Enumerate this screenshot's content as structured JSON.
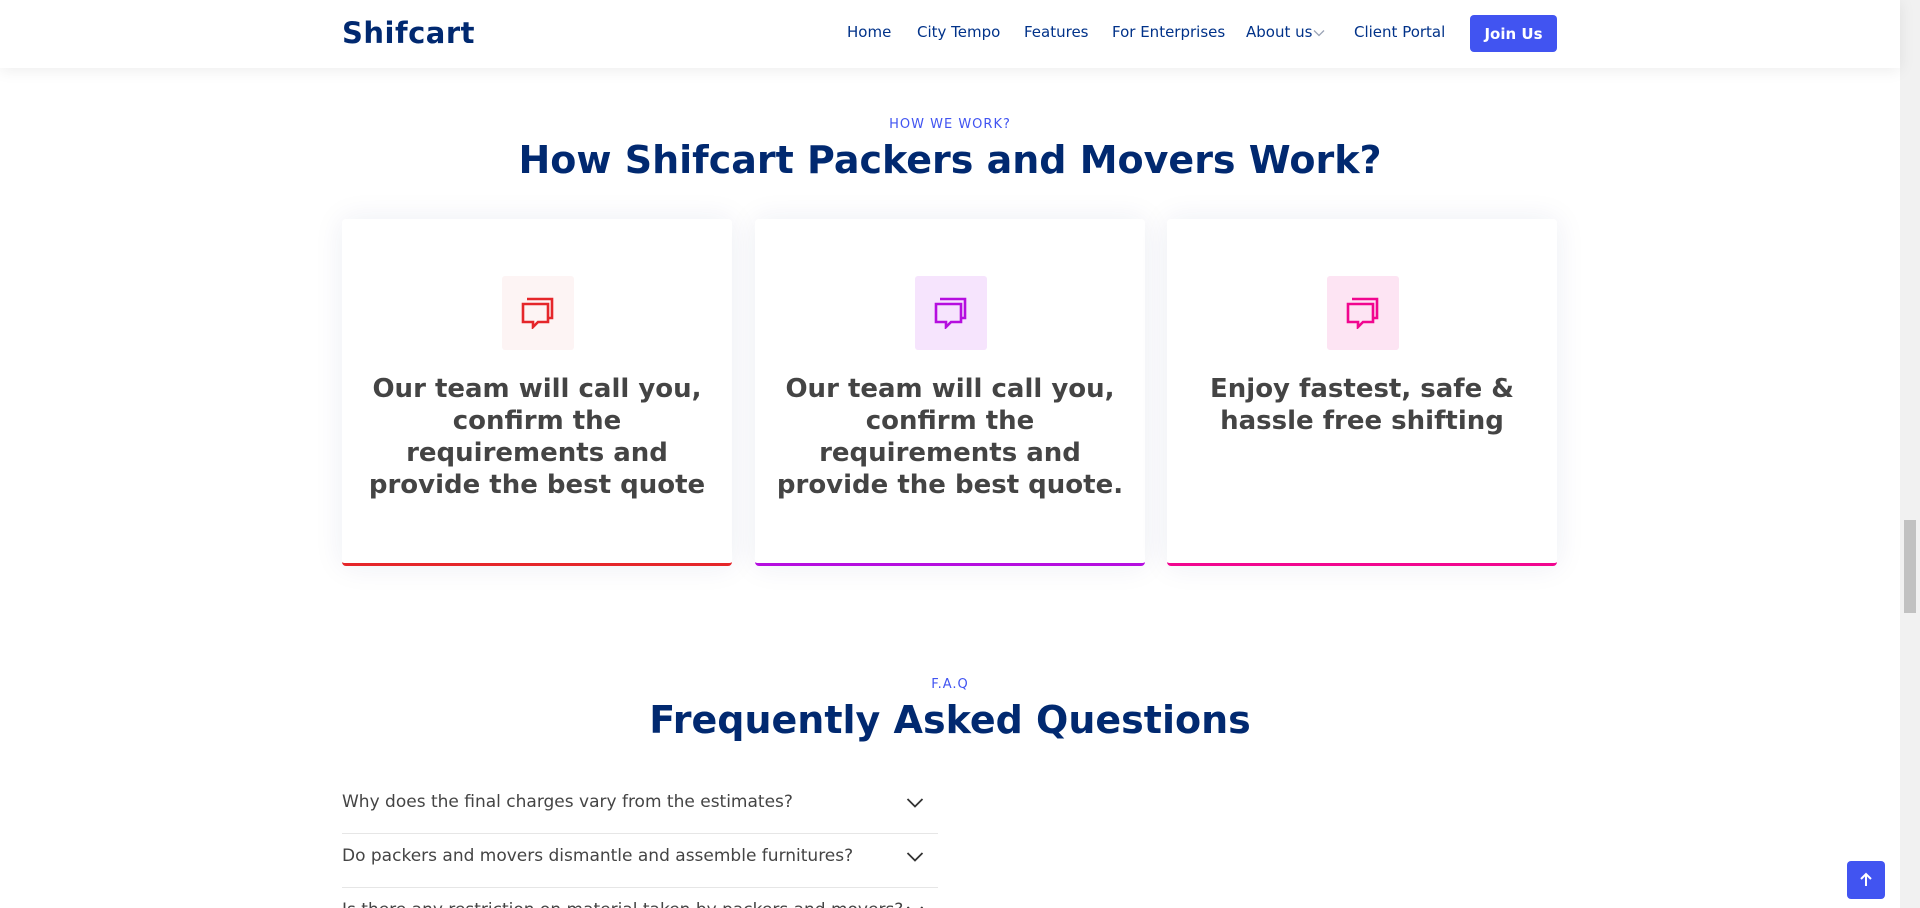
{
  "header": {
    "logo": "Shifcart",
    "nav": [
      "Home",
      "City Tempo",
      "Features",
      "For Enterprises",
      "About us",
      "Client Portal"
    ],
    "join_label": "Join Us",
    "accent": "#4154f1"
  },
  "how": {
    "eyebrow": "HOW WE WORK?",
    "title": "How Shifcart Packers and Movers Work?",
    "cards": [
      {
        "text": "Our team will call you, confirm the requirements and provide the best quote",
        "icon": "chat-icon",
        "color": "#e5262a",
        "bg": "#fdf4f4"
      },
      {
        "text": "Our team will call you, confirm the requirements and provide the best quote.",
        "icon": "chat-icon",
        "color": "#b50edf",
        "bg": "#f6e4fd"
      },
      {
        "text": "Enjoy fastest, safe & hassle free shifting",
        "icon": "chat-icon",
        "color": "#f1068f",
        "bg": "#fde4f3"
      }
    ]
  },
  "faq": {
    "eyebrow": "F.A.Q",
    "title": "Frequently Asked Questions",
    "items": [
      "Why does the final charges vary from the estimates?",
      "Do packers and movers dismantle and assemble furnitures?",
      "Is there any restriction on material taken by packers and movers?"
    ]
  }
}
